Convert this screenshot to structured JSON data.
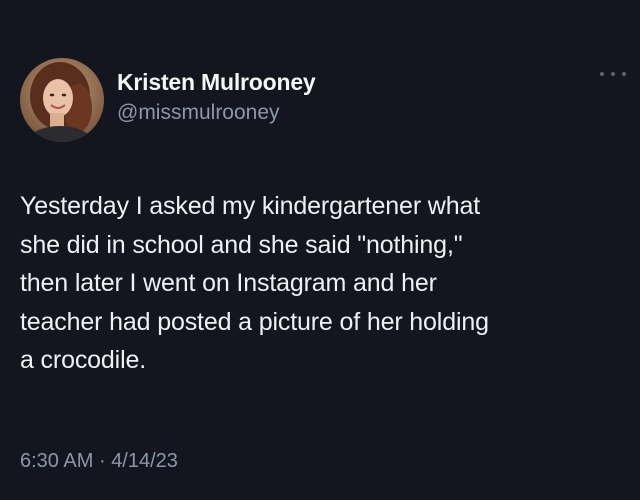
{
  "author": {
    "display_name": "Kristen Mulrooney",
    "handle": "@missmulrooney",
    "avatar_icon": "profile-photo"
  },
  "tweet": {
    "text_lines": [
      "Yesterday I asked my kindergartener what",
      "she did in school and she said \"nothing,\"",
      "then later I went on Instagram and her",
      "teacher had posted a picture of her holding",
      "a crocodile."
    ],
    "time": "6:30 AM",
    "separator": "·",
    "date": "4/14/23"
  },
  "menu": {
    "icon": "more-options-icon"
  },
  "colors": {
    "background": "#13151f",
    "primary_text": "#eef0f3",
    "secondary_text": "#8b98a5"
  }
}
